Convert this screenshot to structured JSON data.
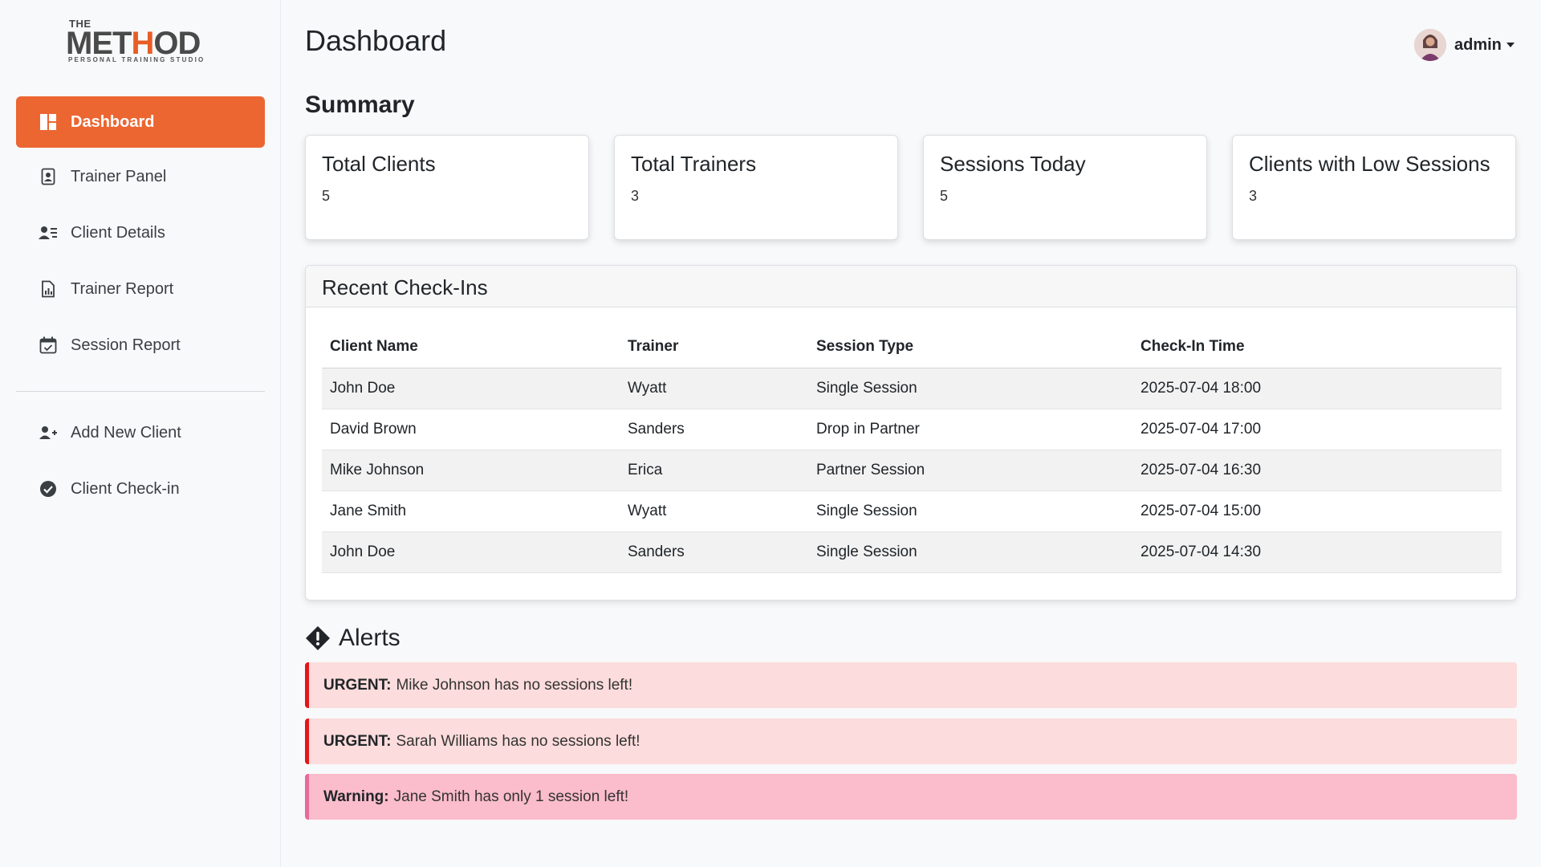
{
  "brand": {
    "the": "THE",
    "word_left": "MET",
    "word_h": "H",
    "word_right": "OD",
    "tagline": "PERSONAL TRAINING STUDIO",
    "accent_color": "#ec6632"
  },
  "sidebar": {
    "items": [
      {
        "label": "Dashboard",
        "icon": "dashboard-icon",
        "active": true
      },
      {
        "label": "Trainer Panel",
        "icon": "id-badge-icon"
      },
      {
        "label": "Client Details",
        "icon": "person-lines-icon"
      },
      {
        "label": "Trainer Report",
        "icon": "file-chart-icon"
      },
      {
        "label": "Session Report",
        "icon": "calendar-check-icon"
      }
    ],
    "secondary": [
      {
        "label": "Add New Client",
        "icon": "person-plus-icon"
      },
      {
        "label": "Client Check-in",
        "icon": "check-circle-icon"
      }
    ]
  },
  "header": {
    "title": "Dashboard",
    "user": "admin"
  },
  "summary": {
    "title": "Summary",
    "cards": [
      {
        "title": "Total Clients",
        "value": "5"
      },
      {
        "title": "Total Trainers",
        "value": "3"
      },
      {
        "title": "Sessions Today",
        "value": "5"
      },
      {
        "title": "Clients with Low Sessions",
        "value": "3"
      }
    ]
  },
  "checkins": {
    "title": "Recent Check-Ins",
    "columns": [
      "Client Name",
      "Trainer",
      "Session Type",
      "Check-In Time"
    ],
    "rows": [
      [
        "John Doe",
        "Wyatt",
        "Single Session",
        "2025-07-04 18:00"
      ],
      [
        "David Brown",
        "Sanders",
        "Drop in Partner",
        "2025-07-04 17:00"
      ],
      [
        "Mike Johnson",
        "Erica",
        "Partner Session",
        "2025-07-04 16:30"
      ],
      [
        "Jane Smith",
        "Wyatt",
        "Single Session",
        "2025-07-04 15:00"
      ],
      [
        "John Doe",
        "Sanders",
        "Single Session",
        "2025-07-04 14:30"
      ]
    ]
  },
  "alerts": {
    "title": "Alerts",
    "items": [
      {
        "level": "URGENT:",
        "text": "Mike Johnson has no sessions left!",
        "color": "#e4151a"
      },
      {
        "level": "URGENT:",
        "text": "Sarah Williams has no sessions left!",
        "color": "#e4151a"
      },
      {
        "level": "Warning:",
        "text": "Jane Smith has only 1 session left!",
        "color": "#e8699a"
      }
    ]
  }
}
